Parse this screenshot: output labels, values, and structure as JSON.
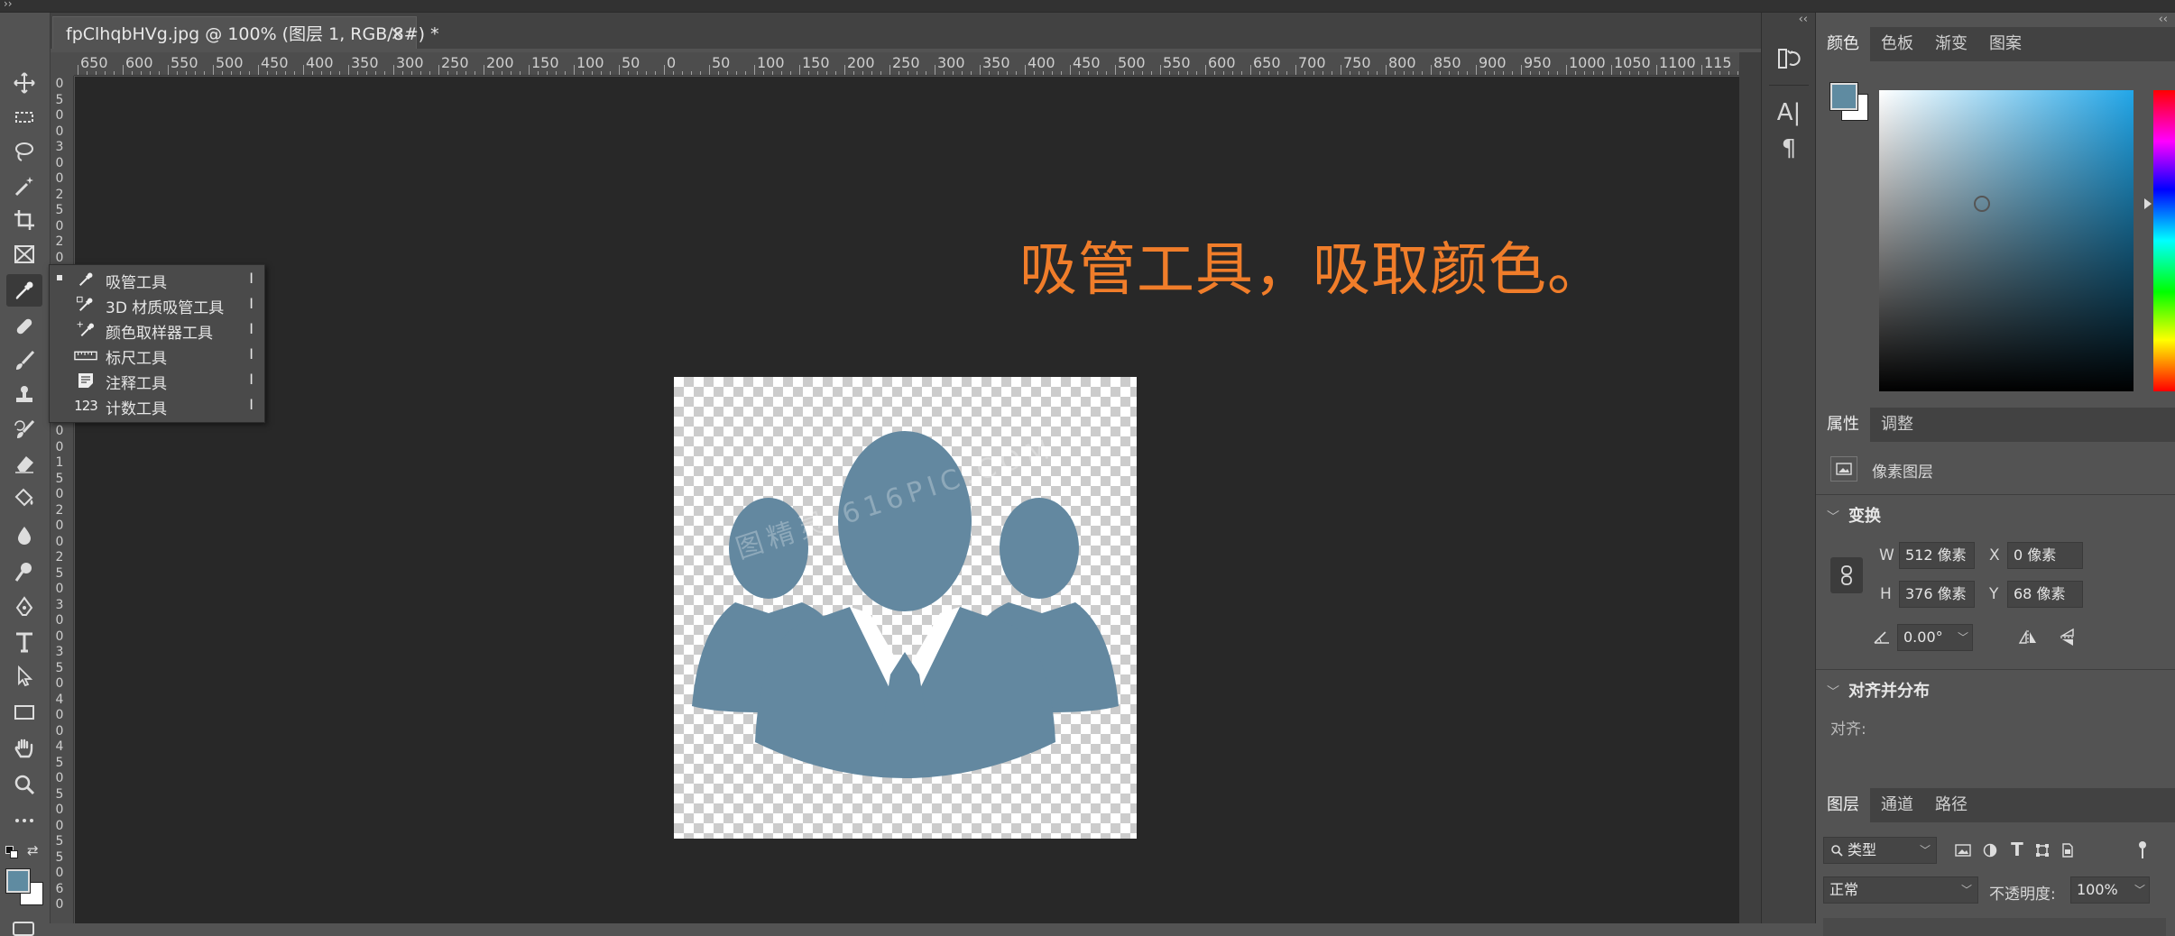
{
  "document": {
    "tab_title": "fpClhqbHVg.jpg @ 100% (图层 1, RGB/8#) *",
    "close_glyph": "×",
    "annotation": "吸管工具，吸取颜色。",
    "watermark": "图精灵 616PIC.COM",
    "silhouette_color": "#6388a0"
  },
  "rulers": {
    "horizontal_ticks": [
      "650",
      "600",
      "550",
      "500",
      "450",
      "400",
      "350",
      "300",
      "250",
      "200",
      "150",
      "100",
      "50",
      "0",
      "50",
      "100",
      "150",
      "200",
      "250",
      "300",
      "350",
      "400",
      "450",
      "500",
      "550",
      "600",
      "650",
      "700",
      "750",
      "800",
      "850",
      "900",
      "950",
      "1000",
      "1050",
      "1100",
      "115"
    ],
    "vertical_ticks": [
      "0",
      "5",
      "0",
      "0",
      "3",
      "0",
      "0",
      "2",
      "5",
      "0",
      "2",
      "0",
      "0",
      "1",
      "5",
      "0",
      "5",
      "0",
      "0",
      "0",
      "5",
      "1",
      "0",
      "0",
      "1",
      "5",
      "0",
      "2",
      "0",
      "0",
      "2",
      "5",
      "0",
      "3",
      "0",
      "0",
      "3",
      "5",
      "0",
      "4",
      "0",
      "0",
      "4",
      "5",
      "0",
      "5",
      "0",
      "0",
      "5",
      "5",
      "0",
      "6",
      "0"
    ]
  },
  "toolbar": {
    "tools": [
      {
        "name": "move-tool",
        "icon": "move-icon"
      },
      {
        "name": "marquee-tool",
        "icon": "marquee-icon"
      },
      {
        "name": "lasso-tool",
        "icon": "lasso-icon"
      },
      {
        "name": "magic-wand-tool",
        "icon": "magic-wand-icon"
      },
      {
        "name": "crop-tool",
        "icon": "crop-icon"
      },
      {
        "name": "frame-tool",
        "icon": "frame-icon"
      },
      {
        "name": "eyedropper-tool",
        "icon": "eyedropper-icon",
        "active": true
      },
      {
        "name": "healing-brush-tool",
        "icon": "bandage-icon"
      },
      {
        "name": "brush-tool",
        "icon": "brush-icon"
      },
      {
        "name": "clone-stamp-tool",
        "icon": "stamp-icon"
      },
      {
        "name": "history-brush-tool",
        "icon": "history-brush-icon"
      },
      {
        "name": "eraser-tool",
        "icon": "eraser-icon"
      },
      {
        "name": "paint-bucket-tool",
        "icon": "bucket-icon"
      },
      {
        "name": "blur-tool",
        "icon": "drop-icon"
      },
      {
        "name": "dodge-tool",
        "icon": "dodge-icon"
      },
      {
        "name": "pen-tool",
        "icon": "pen-icon"
      },
      {
        "name": "type-tool",
        "icon": "type-icon"
      },
      {
        "name": "path-selection-tool",
        "icon": "arrow-icon"
      },
      {
        "name": "rectangle-tool",
        "icon": "rectangle-icon"
      },
      {
        "name": "hand-tool",
        "icon": "hand-icon"
      },
      {
        "name": "zoom-tool",
        "icon": "zoom-icon"
      },
      {
        "name": "more-tools",
        "icon": "ellipsis-icon"
      }
    ],
    "foreground_color": "#5f8ba1",
    "background_color": "#ffffff"
  },
  "flyout": {
    "items": [
      {
        "label": "吸管工具",
        "key": "I",
        "selected": true,
        "icon": "eyedropper-icon"
      },
      {
        "label": "3D 材质吸管工具",
        "key": "I",
        "selected": false,
        "icon": "3d-eyedropper-icon"
      },
      {
        "label": "颜色取样器工具",
        "key": "I",
        "selected": false,
        "icon": "color-sampler-icon"
      },
      {
        "label": "标尺工具",
        "key": "I",
        "selected": false,
        "icon": "ruler-icon"
      },
      {
        "label": "注释工具",
        "key": "I",
        "selected": false,
        "icon": "note-icon"
      },
      {
        "label": "计数工具",
        "key": "I",
        "selected": false,
        "icon": "count-icon",
        "icon_text": "123"
      }
    ]
  },
  "dock": {
    "buttons": [
      {
        "name": "history-button",
        "icon": "history-icon"
      },
      {
        "name": "character-button",
        "icon": "character-icon",
        "glyph": "A|"
      },
      {
        "name": "paragraph-button",
        "icon": "paragraph-icon",
        "glyph": "¶"
      }
    ],
    "collapse_glyph": "‹‹"
  },
  "color_panel": {
    "tabs": [
      "颜色",
      "色板",
      "渐变",
      "图案"
    ],
    "active_tab": 0,
    "foreground_color": "#5f8ba1",
    "background_color": "#ffffff",
    "hue_color": "#22a6e8"
  },
  "properties_panel": {
    "tabs": [
      "属性",
      "调整"
    ],
    "active_tab": 0,
    "layer_type": "像素图层",
    "transform": {
      "title": "变换",
      "w_label": "W",
      "w_value": "512 像素",
      "h_label": "H",
      "h_value": "376 像素",
      "x_label": "X",
      "x_value": "0 像素",
      "y_label": "Y",
      "y_value": "68 像素",
      "angle_value": "0.00°"
    },
    "align": {
      "title": "对齐并分布",
      "label": "对齐:"
    }
  },
  "layers_panel": {
    "tabs": [
      "图层",
      "通道",
      "路径"
    ],
    "active_tab": 0,
    "filter_label": "类型",
    "blend_mode": "正常",
    "opacity_label": "不透明度:",
    "opacity_value": "100%"
  }
}
